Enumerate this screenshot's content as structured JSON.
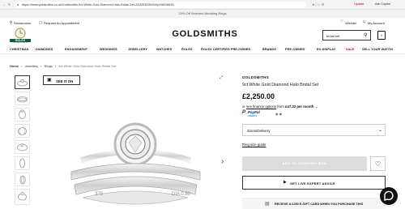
{
  "browser": {
    "url": "https://www.goldsmiths.co.uk/Goldsmiths-9ct-White-Gold-Diamond-Halo-Bridal-Set-ZA3093D5WX8/p/06016630",
    "update_label": "Update",
    "copilot_label": "Ask Copilot"
  },
  "promo": {
    "text": "20% Off Selected Wedding Rings"
  },
  "header": {
    "showrooms": "Showrooms",
    "appointment": "Request An Appointment",
    "logo": "GOLDSMITHS",
    "rolex_badge": "ROLEX",
    "rolex_sub": "OFFICIAL RETAILER",
    "search_value": "bridal set",
    "wishlist": "Wishlist",
    "account": "My Account",
    "bag_count": "0"
  },
  "nav": [
    "CHRISTMAS",
    "DIAMONDS",
    "ENGAGEMENT",
    "WEDDINGS",
    "JEWELLERY",
    "WATCHES",
    "ROLEX",
    "ROLEX CERTIFIED PRE-OWNED",
    "BRANDS",
    "PRE-OWNED",
    "EX-DISPLAY",
    "SALE",
    "SELL YOUR WATCH"
  ],
  "breadcrumb": {
    "home": "Home",
    "sep": "/",
    "jewellery": "Jewellery",
    "rings": "Rings",
    "current": "9ct White Gold Diamond Halo Bridal Set"
  },
  "gallery": {
    "see_it_on": "SEE IT ON"
  },
  "product": {
    "brand": "GOLDSMITHS",
    "name": "9ct White Gold Diamond Halo Bridal Set",
    "price": "£2,250.00",
    "finance_pre": "or",
    "finance_link": "see finance options",
    "finance_mid": "from",
    "finance_amount": "£47.22 per month",
    "paypal_main": "PayPal",
    "paypal_sub": "CREDIT",
    "size_select": "Sizes/Delivery",
    "ring_size_guide": "Ring size guide",
    "add_to_bag": "ADD TO SHOPPING BAG",
    "live_expert": "GET LIVE EXPERT ADVICE",
    "gift_card": "RECEIVE A £250 E-GIFT CARD WHEN YOU PURCHASE THIS"
  }
}
